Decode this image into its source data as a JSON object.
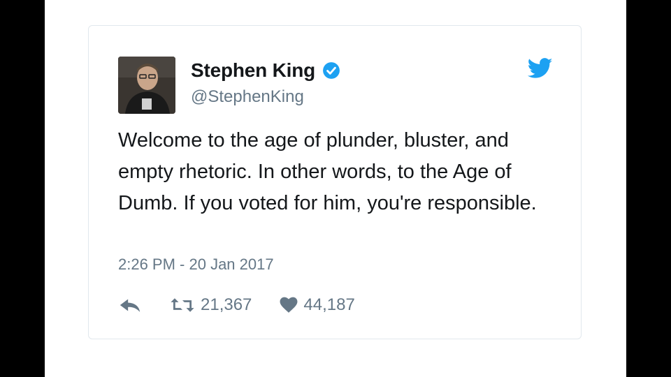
{
  "tweet": {
    "author": {
      "display_name": "Stephen King",
      "handle": "@StephenKing",
      "verified": true,
      "avatar_icon": "author-avatar"
    },
    "text": "Welcome to the age of plunder, bluster, and empty rhetoric. In other words, to the Age of Dumb. If you voted for him, you're responsible.",
    "timestamp": "2:26 PM - 20 Jan 2017",
    "retweets": "21,367",
    "likes": "44,187"
  },
  "icons": {
    "brand": "twitter-bird-icon",
    "verified": "verified-badge-icon",
    "reply": "reply-icon",
    "retweet": "retweet-icon",
    "like": "heart-icon"
  },
  "colors": {
    "brand_blue": "#1da1f2",
    "text": "#14171a",
    "muted": "#657786",
    "border": "#e1e8ed",
    "letterbox": "#000000"
  }
}
